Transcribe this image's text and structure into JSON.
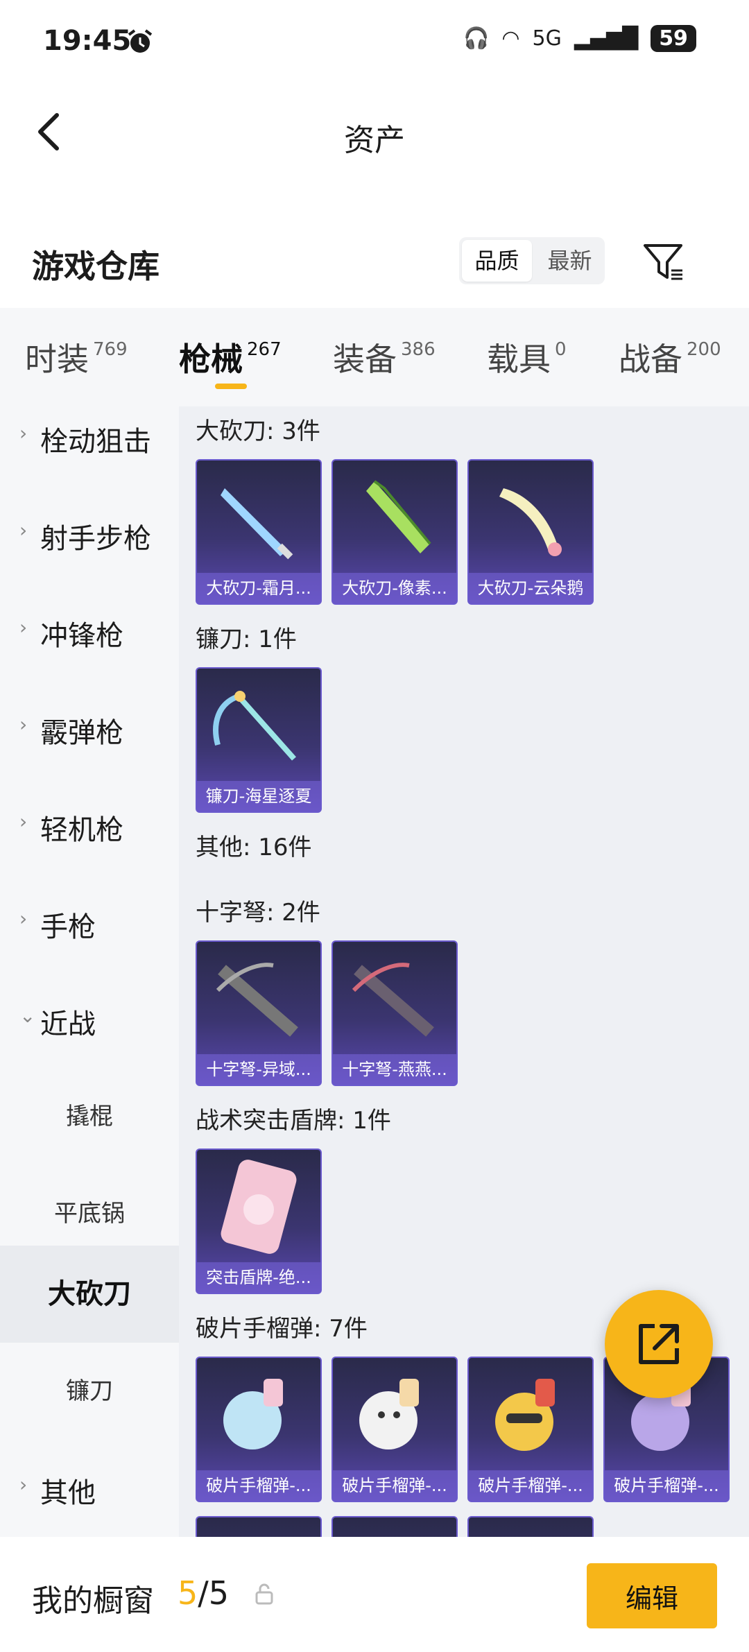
{
  "status": {
    "time": "19:45",
    "battery": "59",
    "network": "5G"
  },
  "header": {
    "title": "资产"
  },
  "warehouse": {
    "title": "游戏仓库",
    "sort_options": [
      "品质",
      "最新"
    ],
    "sort_selected": "品质"
  },
  "tabs": [
    {
      "label": "时装",
      "count": "769"
    },
    {
      "label": "枪械",
      "count": "267",
      "active": true
    },
    {
      "label": "装备",
      "count": "386"
    },
    {
      "label": "载具",
      "count": "0"
    },
    {
      "label": "战备",
      "count": "200"
    }
  ],
  "sidebar": {
    "items": [
      {
        "label": "栓动狙击"
      },
      {
        "label": "射手步枪"
      },
      {
        "label": "冲锋枪"
      },
      {
        "label": "霰弹枪"
      },
      {
        "label": "轻机枪"
      },
      {
        "label": "手枪"
      },
      {
        "label": "近战",
        "expanded": true
      }
    ],
    "sub_items": [
      "撬棍",
      "平底锅",
      "大砍刀",
      "镰刀"
    ],
    "sub_selected": "大砍刀",
    "last_item": "其他"
  },
  "groups": [
    {
      "label": "大砍刀: 3件",
      "items": [
        "大砍刀-霜月...",
        "大砍刀-像素...",
        "大砍刀-云朵鹅"
      ]
    },
    {
      "label": "镰刀: 1件",
      "items": [
        "镰刀-海星逐夏"
      ]
    },
    {
      "label": "其他: 16件",
      "items": []
    },
    {
      "label": "十字弩: 2件",
      "items": [
        "十字弩-异域...",
        "十字弩-燕燕..."
      ]
    },
    {
      "label": "战术突击盾牌: 1件",
      "items": [
        "突击盾牌-绝..."
      ]
    },
    {
      "label": "破片手榴弹: 7件",
      "items": [
        "破片手榴弹-...",
        "破片手榴弹-...",
        "破片手榴弹-...",
        "破片手榴弹-..."
      ]
    }
  ],
  "bottom": {
    "label": "我的橱窗",
    "current": "5",
    "total": "/5",
    "edit_label": "编辑"
  },
  "colors": {
    "accent": "#f7b519",
    "card_bg": "#3b3570"
  }
}
